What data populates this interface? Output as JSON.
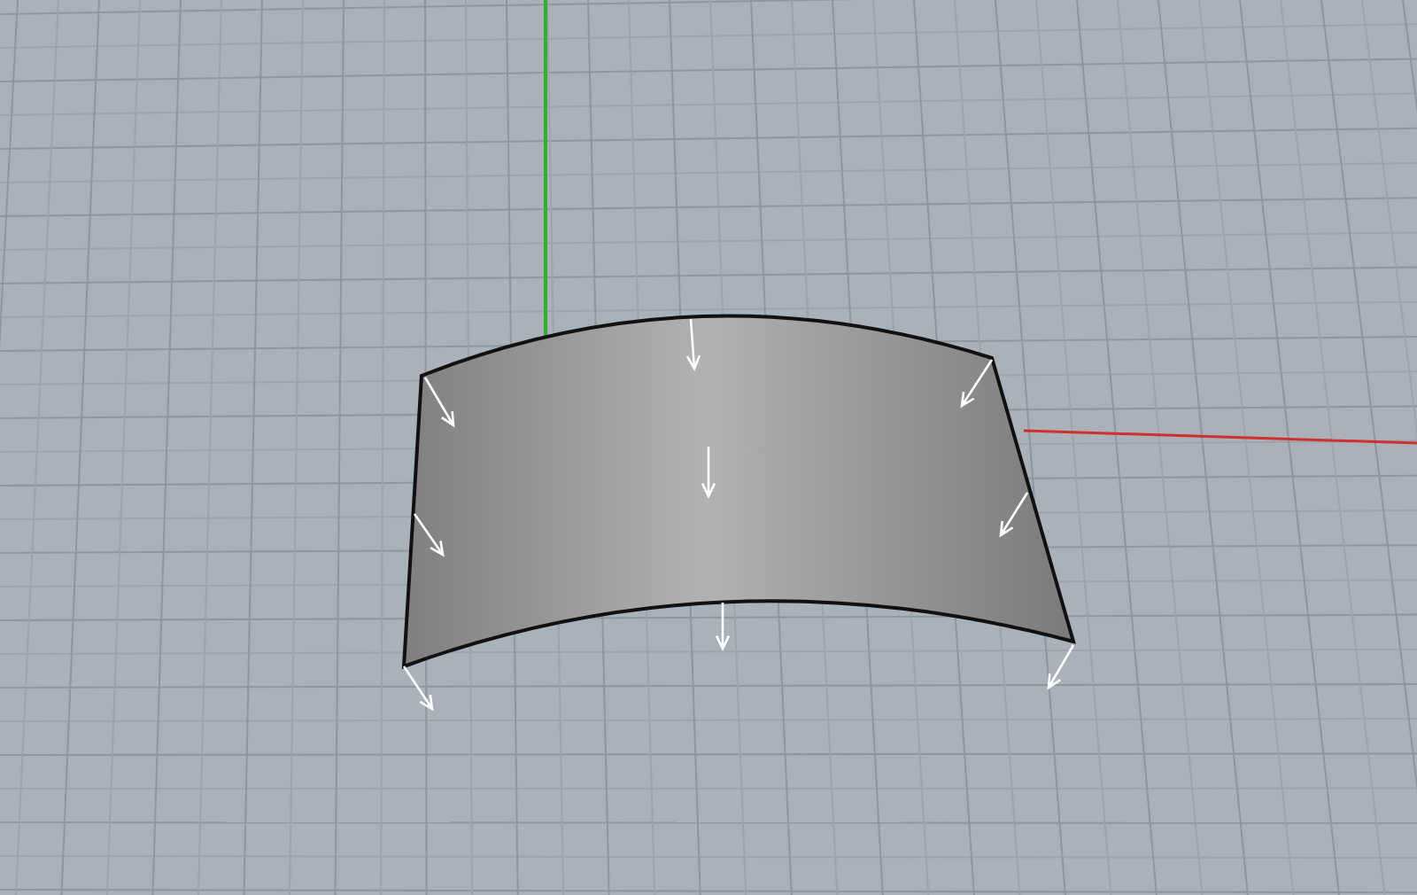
{
  "viewport": {
    "axes": [
      {
        "color": "#2fb12f"
      },
      {
        "color": "#d23030"
      }
    ]
  }
}
